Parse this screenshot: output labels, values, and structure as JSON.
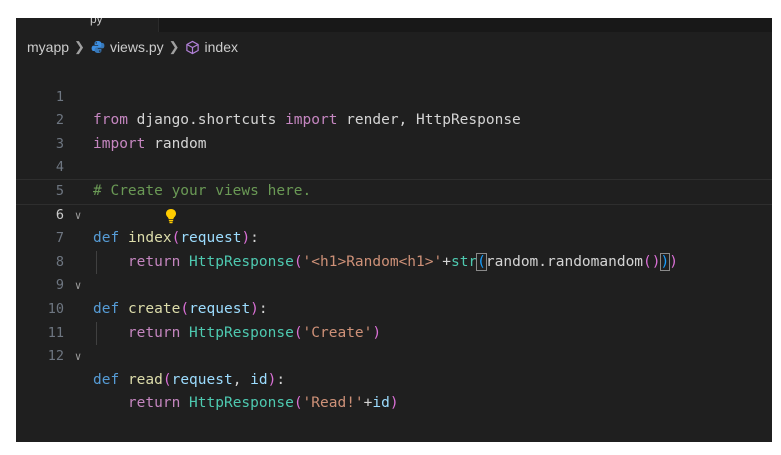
{
  "breadcrumb": {
    "folder": "myapp",
    "file": "views.py",
    "symbol": "index"
  },
  "tab": {
    "partial_label": "py"
  },
  "line_numbers": [
    "1",
    "2",
    "3",
    "4",
    "5",
    "6",
    "7",
    "8",
    "9",
    "10",
    "11",
    "12"
  ],
  "code": {
    "l1": {
      "from": "from",
      "module": " django.shortcuts ",
      "import": "import",
      "names": " render, HttpResponse"
    },
    "l2": {
      "import": "import",
      "module": " random"
    },
    "l4": {
      "comment": "# Create your views here."
    },
    "l5": {
      "def": "def",
      "name": "index",
      "open": "(",
      "param": "request",
      "close": ")",
      "colon": ":"
    },
    "l6": {
      "ret": "return",
      "cls": "HttpResponse",
      "open": "(",
      "str": "'<h1>Random<h1>'",
      "plus": "+",
      "fn": "str",
      "open2": "(",
      "expr": "random.randomandom",
      "open3": "(",
      "close3": ")",
      "close2": ")",
      "close": ")"
    },
    "l8": {
      "def": "def",
      "name": "create",
      "open": "(",
      "param": "request",
      "close": ")",
      "colon": ":"
    },
    "l9": {
      "ret": "return",
      "cls": "HttpResponse",
      "open": "(",
      "str": "'Create'",
      "close": ")"
    },
    "l11": {
      "def": "def",
      "name": "read",
      "open": "(",
      "param": "request",
      "sep": ", ",
      "param2": "id",
      "close": ")",
      "colon": ":"
    },
    "l12": {
      "ret": "return",
      "cls": "HttpResponse",
      "open": "(",
      "str": "'Read!'",
      "plus": "+",
      "param": "id",
      "close": ")"
    }
  },
  "icons": {
    "python_file": "python-icon",
    "symbol": "method-cube-icon",
    "fold": "chevron-down-icon",
    "hint": "lightbulb-icon"
  },
  "colors": {
    "background": "#1f1f1f",
    "keyword_control": "#c586c0",
    "keyword": "#569cd6",
    "function": "#dcdcaa",
    "string": "#ce9178",
    "class": "#4ec9b0",
    "comment": "#6a9955",
    "parameter": "#9cdcfe",
    "lightbulb": "#ffcc00"
  }
}
